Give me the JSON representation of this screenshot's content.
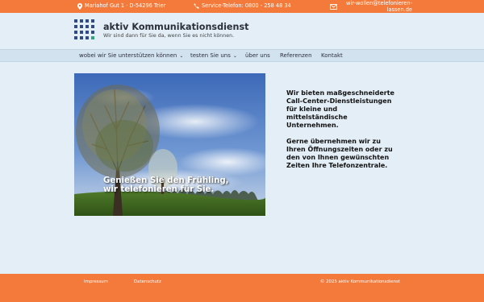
{
  "topbar": {
    "address": "Mariahof Gut 1 · D-54296 Trier",
    "phone": "Service-Telefon: 0800 - 258 48 34",
    "email": "wir-wollen@telefonieren-lassen.de",
    "icons": [
      "map-pin-icon",
      "phone-icon",
      "envelope-icon"
    ]
  },
  "brand": {
    "title": "aktiv Kommunikationsdienst",
    "subtitle": "Wir sind dann für Sie da, wenn Sie es nicht können.",
    "colors": {
      "primary": "#2f4a86",
      "accent": "#2fa37c"
    }
  },
  "nav": {
    "items": [
      {
        "label": "wobei wir Sie unterstützen können",
        "dropdown": true
      },
      {
        "label": "testen Sie uns",
        "dropdown": true
      },
      {
        "label": "über uns",
        "dropdown": false
      },
      {
        "label": "Referenzen",
        "dropdown": false
      },
      {
        "label": "Kontakt",
        "dropdown": false
      }
    ]
  },
  "hero": {
    "caption_line1": "Genießen Sie den Frühling,",
    "caption_line2": "wir telefonieren für Sie."
  },
  "copy": {
    "paragraph1": "Wir bieten maßgeschneiderte Call-Center-Dienstleistungen für kleine und mittelständische Unternehmen.",
    "paragraph2": "Gerne übernehmen wir zu Ihren Öffnungszeiten oder zu den von Ihnen gewünschten Zeiten Ihre Telefonzentrale."
  },
  "footer": {
    "impressum": "Impressum",
    "datenschutz": "Datenschutz",
    "copyright": "© 2025 aktiv Kommunikationsdienst"
  },
  "colors": {
    "orange": "#f47a3c",
    "background": "#e3eef7",
    "nav": "#d2e2ef"
  }
}
